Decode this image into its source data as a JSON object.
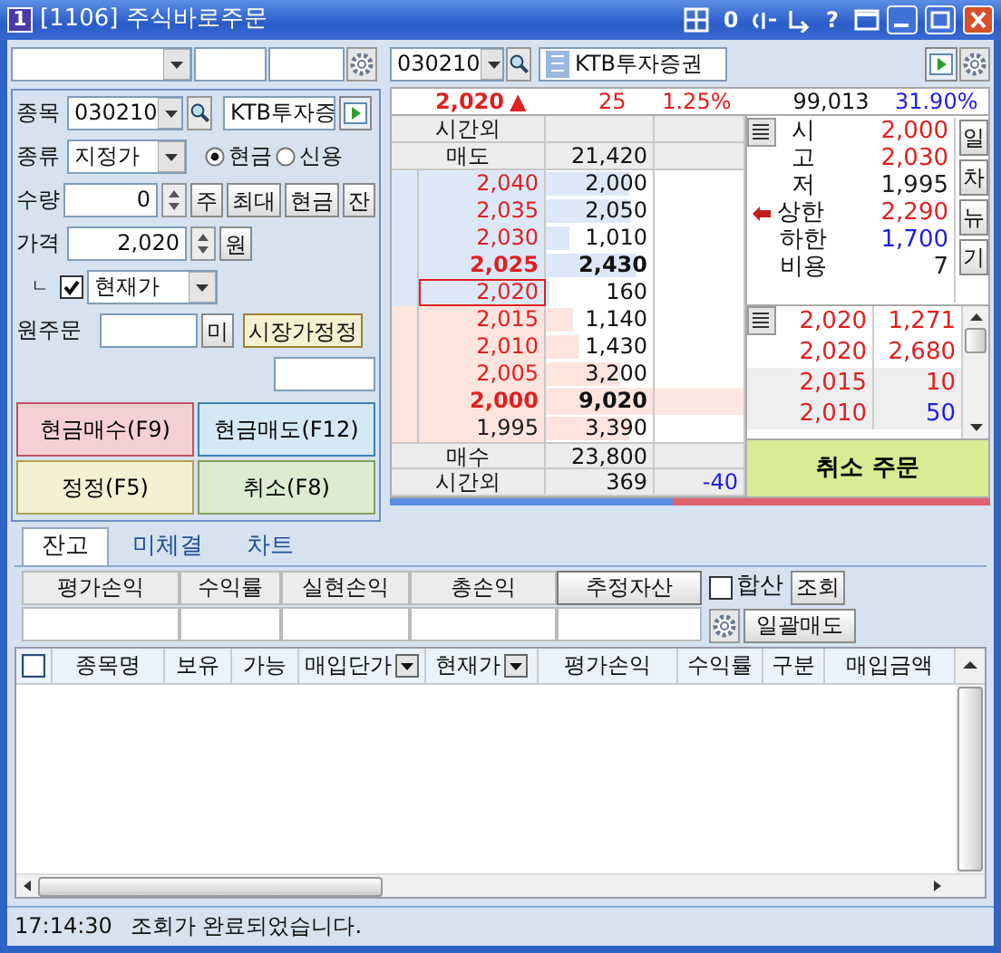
{
  "window": {
    "badge": "1",
    "title": "[1106] 주식바로주문",
    "tool_buttons": [
      "0",
      "?"
    ]
  },
  "order_form": {
    "stock_label": "종목",
    "code": "030210",
    "name": "KTB투자증",
    "type_label": "종류",
    "type": "지정가",
    "radios": [
      {
        "label": "현금",
        "selected": true
      },
      {
        "label": "신용",
        "selected": false
      }
    ],
    "qty_label": "수량",
    "qty": "0",
    "qty_buttons": [
      "주",
      "최대",
      "현금",
      "잔"
    ],
    "price_label": "가격",
    "price": "2,020",
    "price_unit": "원",
    "corner": "ㄴ",
    "price_mode": {
      "checked": true,
      "value": "현재가"
    },
    "orig_label": "원주문",
    "orig_button": "미",
    "market_button": "시장가정정"
  },
  "action_buttons": [
    {
      "label": "현금매수(F9)",
      "kind": "buy"
    },
    {
      "label": "현금매도(F12)",
      "kind": "sell"
    },
    {
      "label": "정정(F5)",
      "kind": "modify"
    },
    {
      "label": "취소(F8)",
      "kind": "cancel"
    }
  ],
  "quote": {
    "code": "030210",
    "name": "KTB투자증권",
    "price": "2,020",
    "arrow": "▲",
    "change": "25",
    "rate": "1.25%",
    "volume": "99,013",
    "turnover": "31.90%"
  },
  "order_book": {
    "top_label": "시간외",
    "ask_label": "매도",
    "ask_total": "21,420",
    "asks": [
      {
        "price": "2,040",
        "qty": "2,000",
        "level": 0.78,
        "bold": false,
        "selected": false,
        "color": "#e02020"
      },
      {
        "price": "2,035",
        "qty": "2,050",
        "level": 0.8,
        "bold": false,
        "selected": false,
        "color": "#e02020"
      },
      {
        "price": "2,030",
        "qty": "1,010",
        "level": 0.22,
        "bold": false,
        "selected": false,
        "color": "#e02020"
      },
      {
        "price": "2,025",
        "qty": "2,430",
        "level": 0.85,
        "bold": true,
        "selected": false,
        "color": "#e02020"
      },
      {
        "price": "2,020",
        "qty": "160",
        "level": 0.04,
        "bold": false,
        "selected": true,
        "color": "#e02020"
      }
    ],
    "bids": [
      {
        "price": "2,015",
        "qty": "1,140",
        "level": 0.25,
        "bold": false,
        "color": "#e02020"
      },
      {
        "price": "2,010",
        "qty": "1,430",
        "level": 0.3,
        "bold": false,
        "color": "#e02020"
      },
      {
        "price": "2,005",
        "qty": "3,200",
        "level": 0.7,
        "bold": false,
        "color": "#e02020"
      },
      {
        "price": "2,000",
        "qty": "9,020",
        "level": 1,
        "bold": true,
        "color": "#e02020"
      },
      {
        "price": "1,995",
        "qty": "3,390",
        "level": 0.78,
        "bold": false,
        "color": "#202020"
      }
    ],
    "bid_label": "매수",
    "bid_total": "23,800",
    "after_label": "시간외",
    "after_qty": "369",
    "after_change": "-40",
    "ratio_bar": {
      "level": 0.47
    }
  },
  "price_info": [
    {
      "label": "시",
      "value": "2,000",
      "color": "#e02020",
      "marker": false
    },
    {
      "label": "고",
      "value": "2,030",
      "color": "#e02020",
      "marker": false
    },
    {
      "label": "저",
      "value": "1,995",
      "color": "#202020",
      "marker": false
    },
    {
      "label": "상한",
      "value": "2,290",
      "color": "#e02020",
      "marker": true
    },
    {
      "label": "하한",
      "value": "1,700",
      "color": "#2020e0",
      "marker": false
    },
    {
      "label": "비용",
      "value": "7",
      "color": "#202020",
      "marker": false
    }
  ],
  "side_buttons": [
    "일",
    "차",
    "뉴",
    "기"
  ],
  "ticks": [
    {
      "price": "2,020",
      "qty": "1,271",
      "color": "#e02020"
    },
    {
      "price": "2,020",
      "qty": "2,680",
      "color": "#e02020"
    },
    {
      "price": "2,015",
      "qty": "10",
      "color": "#e02020"
    },
    {
      "price": "2,010",
      "qty": "50",
      "color": "#2020e0"
    }
  ],
  "cancel_order": "취소 주문",
  "tabs": [
    {
      "label": "잔고",
      "selected": true
    },
    {
      "label": "미체결",
      "selected": false
    },
    {
      "label": "차트",
      "selected": false
    }
  ],
  "summary": {
    "columns": [
      {
        "label": "평가손익",
        "kind": "plain"
      },
      {
        "label": "수익률",
        "kind": "plain"
      },
      {
        "label": "실현손익",
        "kind": "plain"
      },
      {
        "label": "총손익",
        "kind": "plain"
      },
      {
        "label": "추정자산",
        "kind": "button"
      }
    ],
    "sum_checkbox": {
      "label": "합산",
      "checked": false
    },
    "query_button": "조회",
    "sell_all_button": "일괄매도"
  },
  "grid": {
    "select_all": false,
    "columns": [
      {
        "label": "종목명",
        "kind": "plain"
      },
      {
        "label": "보유",
        "kind": "plain"
      },
      {
        "label": "가능",
        "kind": "plain"
      },
      {
        "label": "매입단가",
        "kind": "dropdown"
      },
      {
        "label": "현재가",
        "kind": "dropdown"
      },
      {
        "label": "평가손익",
        "kind": "plain"
      },
      {
        "label": "수익률",
        "kind": "plain"
      },
      {
        "label": "구분",
        "kind": "plain"
      },
      {
        "label": "매입금액",
        "kind": "plain"
      }
    ]
  },
  "status_bar": {
    "time": "17:14:30",
    "message": "조회가 완료되었습니다."
  }
}
